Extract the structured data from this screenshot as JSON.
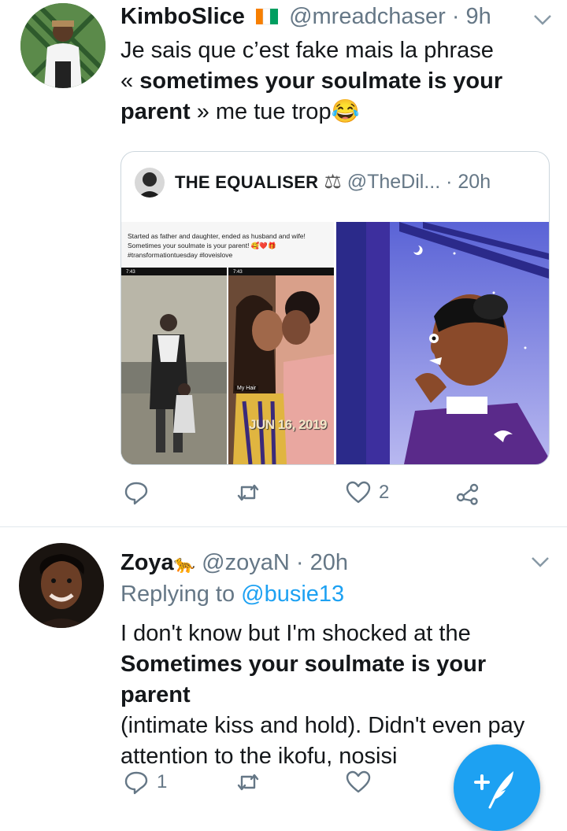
{
  "tweet1": {
    "name": "KimboSlice",
    "flag": "🇨🇮",
    "handle": "@mreadchaser",
    "time": "· 9h",
    "text_line1": "Je sais que c’est fake mais la phrase",
    "text_line2_prefix": "« ",
    "text_line2_bold": "sometimes your soulmate is your",
    "text_line3_bold": "parent",
    "text_line3_rest": " » me tue trop",
    "emoji": "😂",
    "quoted": {
      "name": "THE EQUALISER",
      "scale_symbol": "⚖",
      "handle": "@TheDil...",
      "time": "· 20h",
      "screenshot_caption": "Started as father and daughter, ended as husband and wife! Sometimes your soulmate is your parent! 🥰❤️🎁 #transformationtuesday #loveislove",
      "phone_time": "7:43",
      "date_stamp": "JUN 16, 2019",
      "hair_sticker": "My Hair"
    },
    "actions": {
      "replies": "",
      "retweets": "",
      "likes": "2"
    }
  },
  "tweet2": {
    "name": "Zoya",
    "emoji": "🐆",
    "handle": "@zoyaN",
    "time": "· 20h",
    "replying_prefix": "Replying to ",
    "replying_handle": "@busie13",
    "line1": "I don't know but I'm shocked at the",
    "line2_bold": "Sometimes your soulmate is your parent",
    "line3": "(intimate kiss and hold). Didn't even pay",
    "line4": "attention to the ikofu, nosisi",
    "actions": {
      "replies": "1",
      "retweets": "",
      "likes": ""
    }
  },
  "colors": {
    "accent": "#1da1f2",
    "secondary_text": "#657786",
    "divider": "#e1e8ed"
  },
  "fab": {
    "icon": "compose-icon"
  }
}
